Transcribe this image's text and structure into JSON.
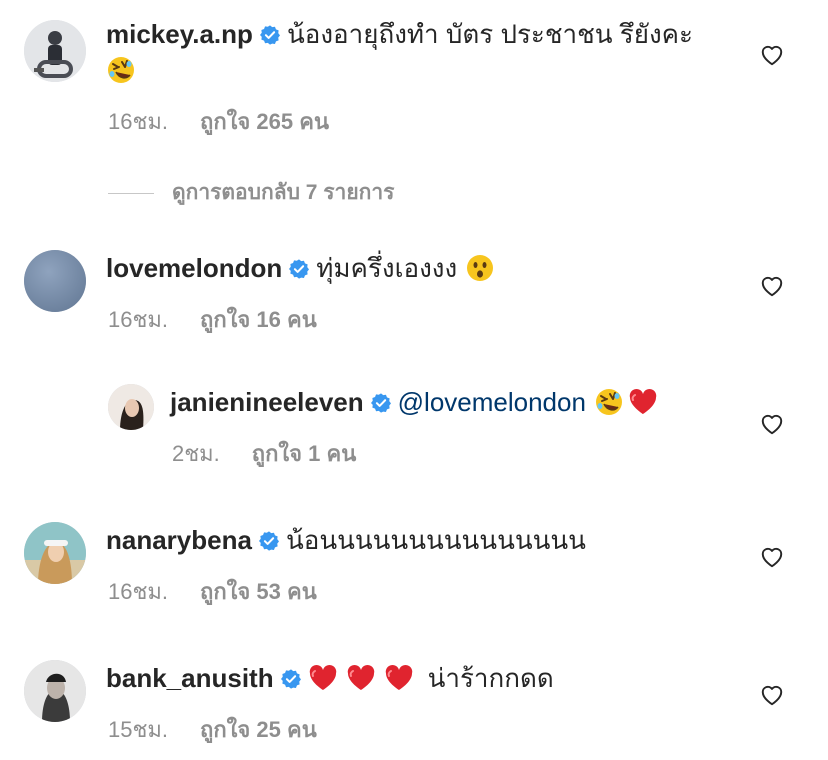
{
  "comments": [
    {
      "username": "mickey.a.np",
      "text": "น้องอายุถึงทำ บัตร ประชาชน รึยังคะ",
      "time": "16ชม.",
      "likes": "ถูกใจ 265 คน"
    },
    {
      "username": "lovemelondon",
      "text": "ทุ่มครึ่งเองงง",
      "time": "16ชม.",
      "likes": "ถูกใจ 16 คน"
    },
    {
      "username": "janienineeleven",
      "mention": "@lovemelondon",
      "time": "2ชม.",
      "likes": "ถูกใจ 1 คน"
    },
    {
      "username": "nanarybena",
      "text": "น้อนนนนนนนนนนนนนนน",
      "time": "16ชม.",
      "likes": "ถูกใจ 53 คน"
    },
    {
      "username": "bank_anusith",
      "text": "น่าร้ากกดด",
      "time": "15ชม.",
      "likes": "ถูกใจ 25 คน"
    }
  ],
  "view_replies": "ดูการตอบกลับ 7 รายการ",
  "colors": {
    "verified": "#3897f0",
    "mention": "#00376b",
    "meta": "#8e8e8e"
  },
  "icons": [
    "verified-badge-icon",
    "heart-outline-icon",
    "rofl-emoji-icon",
    "surprised-emoji-icon",
    "red-heart-emoji-icon"
  ]
}
